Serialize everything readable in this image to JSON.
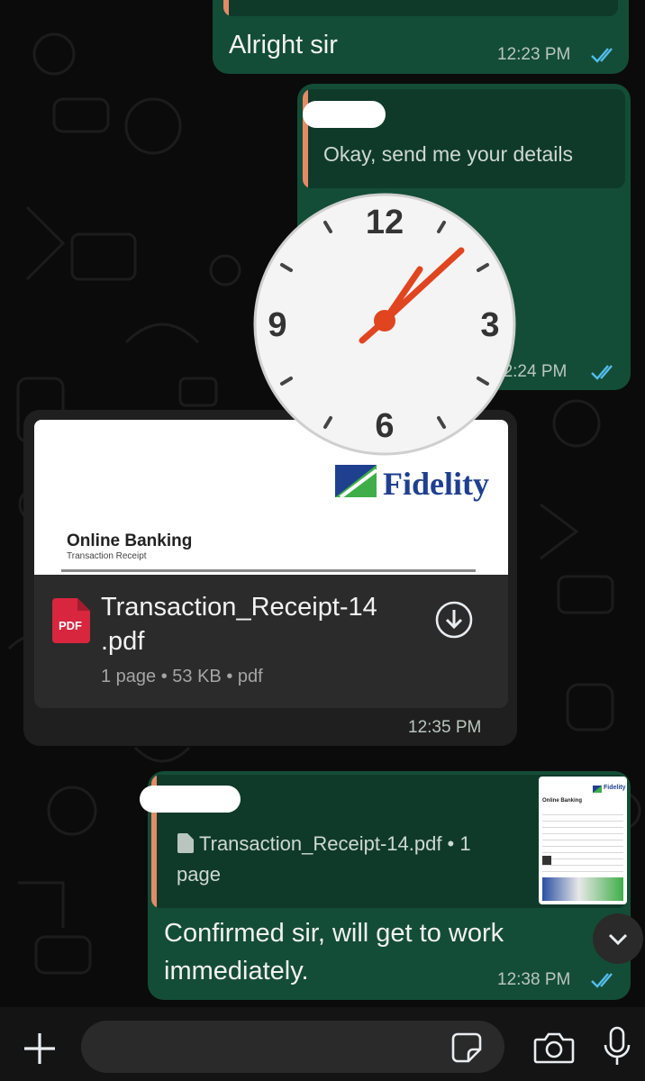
{
  "messages": {
    "m1": {
      "text": "Alright sir",
      "time": "12:23 PM"
    },
    "m2": {
      "quote_text": "Okay, send me your details",
      "time": "12:24 PM"
    },
    "m3": {
      "brand": "Fidelity",
      "preview_title": "Online Banking",
      "preview_subtitle": "Transaction Receipt",
      "file_badge": "PDF",
      "file_name_line1": "Transaction_Receipt-14",
      "file_name_line2": ".pdf",
      "file_meta": "1 page • 53 KB • pdf",
      "time": "12:35 PM"
    },
    "m4": {
      "quote_file_line1": "Transaction_Receipt-14.pdf • 1",
      "quote_file_line2": "page",
      "thumb_brand": "Fidelity",
      "thumb_title": "Online Banking",
      "text_line1": "Confirmed sir, will get to work",
      "text_line2": "immediately.",
      "time": "12:38 PM"
    }
  },
  "clock": {
    "n12": "12",
    "n3": "3",
    "n6": "6",
    "n9": "9",
    "hand_color": "#e0451f"
  },
  "colors": {
    "bubble_out": "#144d37",
    "bubble_in": "#1f1f1f",
    "quote_bar": "#e58a67",
    "ticks": "#53bdeb",
    "pdf_red": "#d7263d"
  },
  "icons": [
    "plus-icon",
    "sticker-icon",
    "camera-icon",
    "microphone-icon",
    "chevron-down-icon",
    "download-icon",
    "double-check-icon",
    "file-icon"
  ]
}
